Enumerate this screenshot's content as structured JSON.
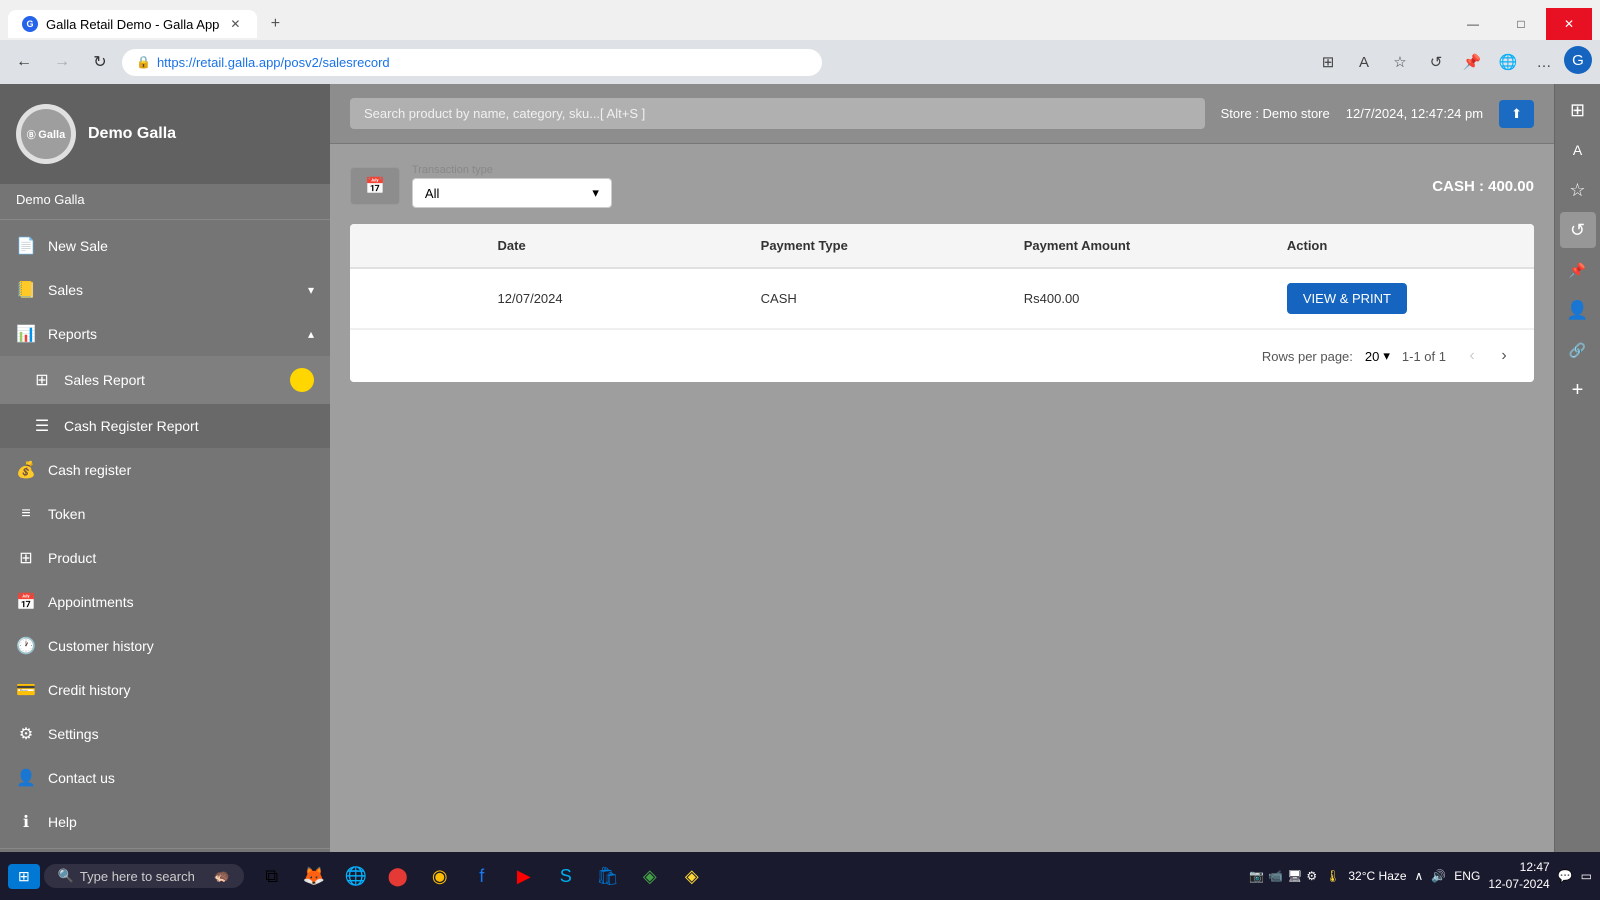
{
  "browser": {
    "tab_title": "Galla Retail Demo - Galla App",
    "tab_url": "https://retail.galla.app/posv2/salesrecord",
    "new_tab_label": "+",
    "minimize": "—",
    "maximize": "□",
    "close": "✕"
  },
  "header": {
    "search_placeholder": "Search product by name, category, sku...[ Alt+S ]",
    "store_label": "Store : Demo store",
    "datetime": "12/7/2024, 12:47:24 pm",
    "upload_label": "↑"
  },
  "sidebar": {
    "company_name": "Demo Galla",
    "logo_text": "Galla",
    "username": "Demo Galla",
    "nav_items": [
      {
        "id": "new-sale",
        "label": "New Sale",
        "icon": "📄",
        "has_arrow": false
      },
      {
        "id": "sales",
        "label": "Sales",
        "icon": "📒",
        "has_arrow": true
      },
      {
        "id": "reports",
        "label": "Reports",
        "icon": "📊",
        "has_arrow": true,
        "expanded": true
      },
      {
        "id": "sales-report",
        "label": "Sales Report",
        "icon": "⊞",
        "submenu": true,
        "has_dot": true
      },
      {
        "id": "cash-register-report",
        "label": "Cash Register Report",
        "icon": "☰",
        "submenu": true
      },
      {
        "id": "cash-register",
        "label": "Cash register",
        "icon": "💰",
        "has_arrow": false
      },
      {
        "id": "token",
        "label": "Token",
        "icon": "≡",
        "has_arrow": false
      },
      {
        "id": "product",
        "label": "Product",
        "icon": "⊞",
        "has_arrow": false
      },
      {
        "id": "appointments",
        "label": "Appointments",
        "icon": "📅",
        "has_arrow": false
      },
      {
        "id": "customer-history",
        "label": "Customer history",
        "icon": "🕐",
        "has_arrow": false
      },
      {
        "id": "credit-history",
        "label": "Credit history",
        "icon": "💳",
        "has_arrow": false
      },
      {
        "id": "settings",
        "label": "Settings",
        "icon": "⚙",
        "has_arrow": false
      },
      {
        "id": "contact-us",
        "label": "Contact us",
        "icon": "👤",
        "has_arrow": false
      },
      {
        "id": "help",
        "label": "Help",
        "icon": "ℹ",
        "has_arrow": false
      }
    ]
  },
  "content": {
    "transaction_type_label": "Transaction type",
    "transaction_type_value": "All",
    "cash_total": "CASH : 400.00",
    "table_headers": [
      "",
      "Date",
      "Payment Type",
      "Payment Amount",
      "Action"
    ],
    "table_rows": [
      {
        "date": "12/07/2024",
        "payment_type": "CASH",
        "payment_amount": "Rs400.00",
        "action_label": "VIEW & PRINT"
      }
    ],
    "rows_per_page_label": "Rows per page:",
    "rows_per_page_value": "20",
    "page_info": "1-1 of 1"
  },
  "right_panel_icons": [
    "🗔",
    "A",
    "☆",
    "↺",
    "📌",
    "🌐",
    "…"
  ],
  "taskbar": {
    "start_icon": "⊞",
    "search_placeholder": "Type here to search",
    "time": "12:47",
    "date": "12-07-2024",
    "temp": "32°C Haze",
    "lang": "ENG"
  }
}
